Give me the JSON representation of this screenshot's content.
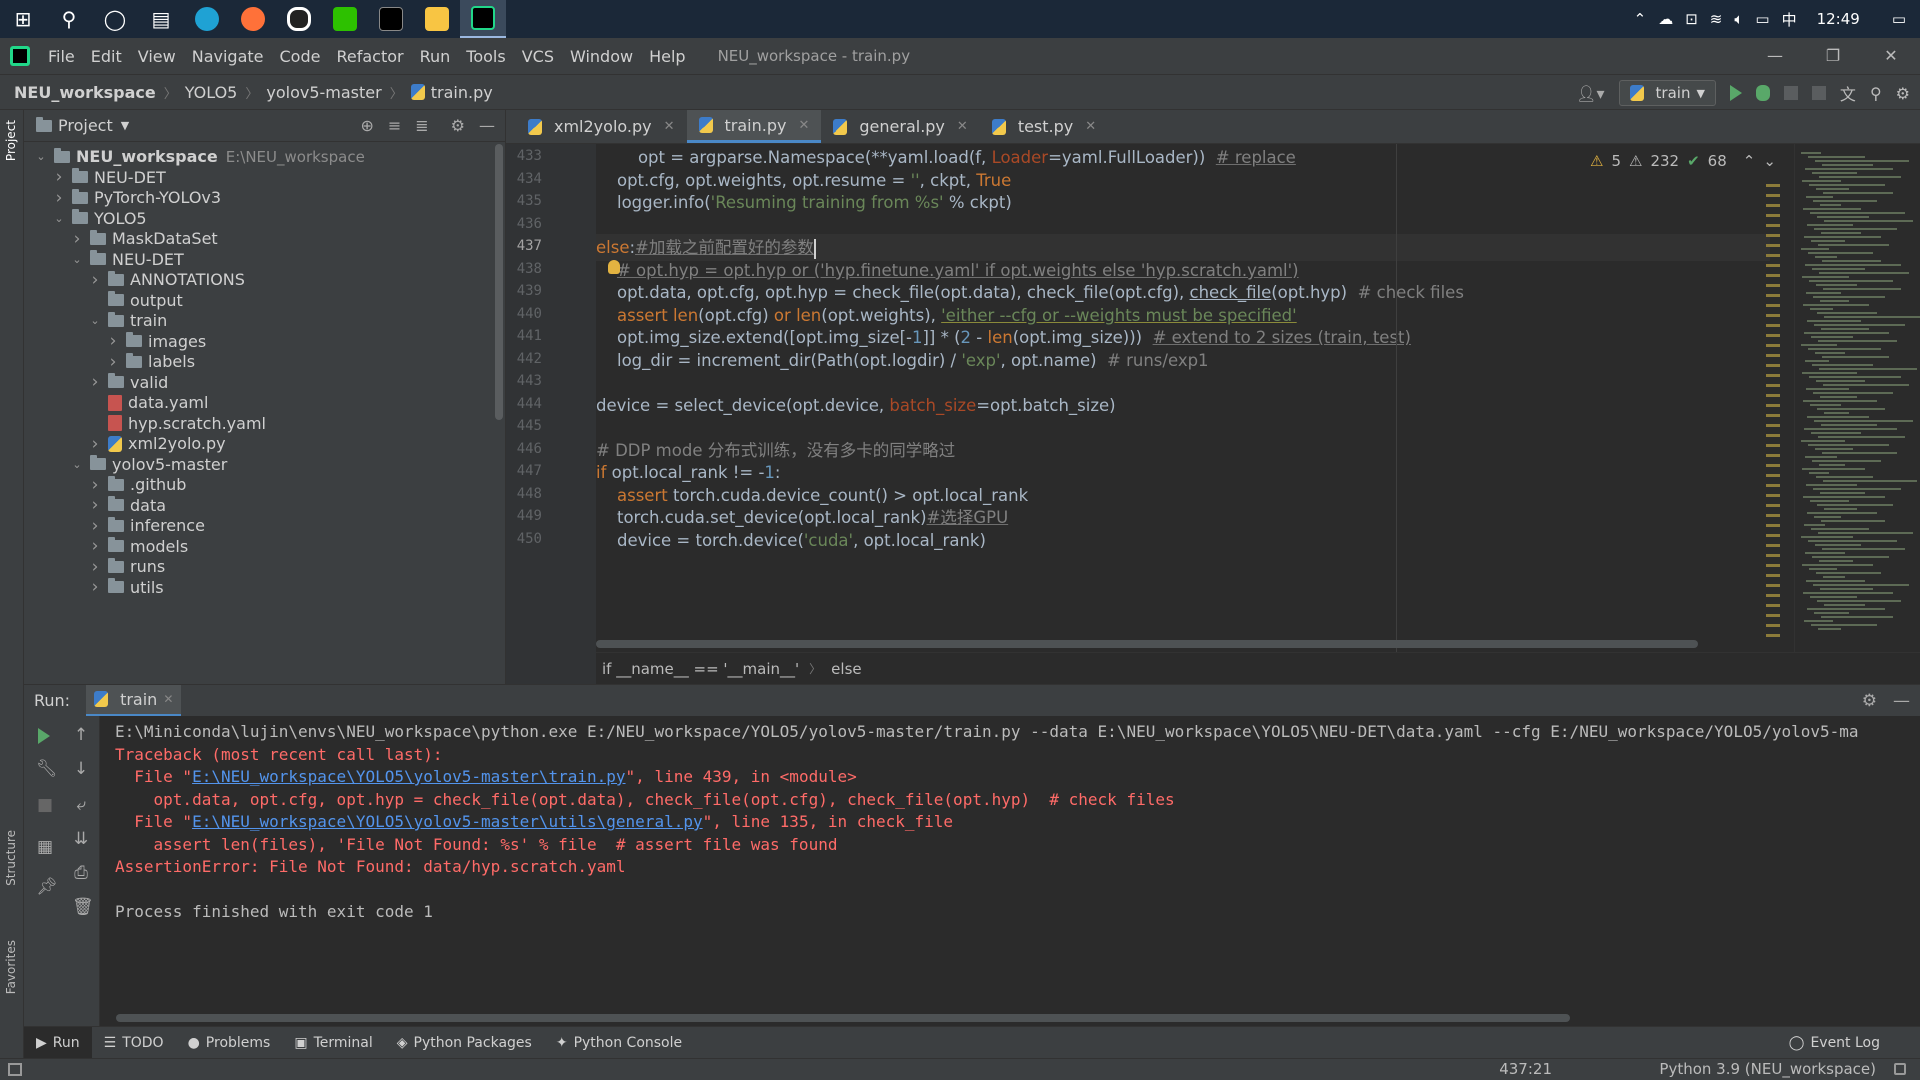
{
  "taskbar": {
    "clock": "12:49",
    "ime": "中",
    "apps": [
      "windows-start",
      "search",
      "cortana",
      "task-view",
      "edge",
      "firefox",
      "qq",
      "wechat",
      "terminal",
      "file-explorer",
      "pycharm"
    ]
  },
  "menubar": {
    "items": [
      "File",
      "Edit",
      "View",
      "Navigate",
      "Code",
      "Refactor",
      "Run",
      "Tools",
      "VCS",
      "Window",
      "Help"
    ],
    "window_title": "NEU_workspace - train.py"
  },
  "navbar": {
    "crumbs": [
      "NEU_workspace",
      "YOLO5",
      "yolov5-master",
      "train.py"
    ],
    "run_config": "train"
  },
  "project": {
    "title": "Project",
    "root_path": "E:\\NEU_workspace",
    "tree": [
      {
        "label": "NEU_workspace",
        "type": "folder",
        "depth": 0,
        "expanded": true
      },
      {
        "label": "NEU-DET",
        "type": "folder",
        "depth": 1,
        "expanded": false
      },
      {
        "label": "PyTorch-YOLOv3",
        "type": "folder",
        "depth": 1,
        "expanded": false
      },
      {
        "label": "YOLO5",
        "type": "folder",
        "depth": 1,
        "expanded": true
      },
      {
        "label": "MaskDataSet",
        "type": "folder",
        "depth": 2,
        "expanded": false
      },
      {
        "label": "NEU-DET",
        "type": "folder",
        "depth": 2,
        "expanded": true
      },
      {
        "label": "ANNOTATIONS",
        "type": "folder",
        "depth": 3,
        "expanded": false
      },
      {
        "label": "output",
        "type": "folder",
        "depth": 3,
        "expanded": null
      },
      {
        "label": "train",
        "type": "folder",
        "depth": 3,
        "expanded": true
      },
      {
        "label": "images",
        "type": "folder",
        "depth": 4,
        "expanded": false
      },
      {
        "label": "labels",
        "type": "folder",
        "depth": 4,
        "expanded": false
      },
      {
        "label": "valid",
        "type": "folder",
        "depth": 3,
        "expanded": false
      },
      {
        "label": "data.yaml",
        "type": "yaml",
        "depth": 3,
        "expanded": null
      },
      {
        "label": "hyp.scratch.yaml",
        "type": "yaml",
        "depth": 3,
        "expanded": null
      },
      {
        "label": "xml2yolo.py",
        "type": "py",
        "depth": 3,
        "expanded": false
      },
      {
        "label": "yolov5-master",
        "type": "folder",
        "depth": 2,
        "expanded": true
      },
      {
        "label": ".github",
        "type": "folder",
        "depth": 3,
        "expanded": false
      },
      {
        "label": "data",
        "type": "folder",
        "depth": 3,
        "expanded": false
      },
      {
        "label": "inference",
        "type": "folder",
        "depth": 3,
        "expanded": false
      },
      {
        "label": "models",
        "type": "folder",
        "depth": 3,
        "expanded": false
      },
      {
        "label": "runs",
        "type": "folder",
        "depth": 3,
        "expanded": false
      },
      {
        "label": "utils",
        "type": "folder",
        "depth": 3,
        "expanded": false
      }
    ]
  },
  "tabs": [
    {
      "label": "xml2yolo.py",
      "active": false
    },
    {
      "label": "train.py",
      "active": true
    },
    {
      "label": "general.py",
      "active": false
    },
    {
      "label": "test.py",
      "active": false
    }
  ],
  "inspections": {
    "warnings": "5",
    "weak_warnings": "232",
    "typos": "68"
  },
  "editor": {
    "line_numbers": [
      "433",
      "434",
      "435",
      "436",
      "437",
      "438",
      "439",
      "440",
      "441",
      "442",
      "443",
      "444",
      "445",
      "446",
      "447",
      "448",
      "449",
      "450"
    ],
    "current_line": "437"
  },
  "editor_breadcrumb": [
    "if __name__ == '__main__'",
    "else"
  ],
  "run": {
    "label": "Run:",
    "tab": "train",
    "output": {
      "cmd": "E:\\Miniconda\\lujin\\envs\\NEU_workspace\\python.exe E:/NEU_workspace/YOLO5/yolov5-master/train.py --data E:\\NEU_workspace\\YOLO5\\NEU-DET\\data.yaml --cfg E:/NEU_workspace/YOLO5/yolov5-ma",
      "traceback": "Traceback (most recent call last):",
      "f1_pre": "  File \"",
      "f1_link": "E:\\NEU_workspace\\YOLO5\\yolov5-master\\train.py",
      "f1_post": "\", line 439, in <module>",
      "f1_code": "    opt.data, opt.cfg, opt.hyp = check_file(opt.data), check_file(opt.cfg), check_file(opt.hyp)  # check files",
      "f2_pre": "  File \"",
      "f2_link": "E:\\NEU_workspace\\YOLO5\\yolov5-master\\utils\\general.py",
      "f2_post": "\", line 135, in check_file",
      "f2_code": "    assert len(files), 'File Not Found: %s' % file  # assert file was found",
      "error": "AssertionError: File Not Found: data/hyp.scratch.yaml",
      "exit": "Process finished with exit code 1"
    }
  },
  "bottom_tabs": [
    "Run",
    "TODO",
    "Problems",
    "Terminal",
    "Python Packages",
    "Python Console"
  ],
  "event_log": "Event Log",
  "status": {
    "position": "437:21",
    "interpreter": "Python 3.9 (NEU_workspace)"
  },
  "side_labels": {
    "project": "Project",
    "structure": "Structure",
    "favorites": "Favorites"
  },
  "colors": {
    "accent": "#4a88c7",
    "error": "#ff6b68",
    "link": "#5394ec",
    "run_green": "#59a869"
  }
}
